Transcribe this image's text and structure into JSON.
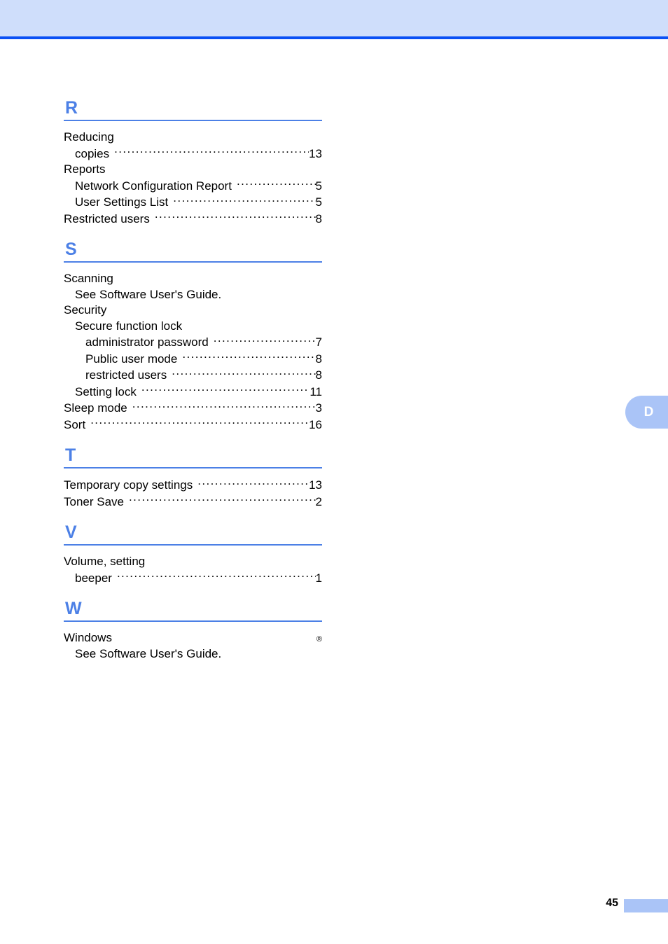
{
  "document": {
    "page_number": "45",
    "chapter_tab_letter": "D"
  },
  "colors": {
    "header_band": "#cfdefb",
    "header_rule": "#0a50f5",
    "section_letter": "#4c80e6",
    "section_rule": "#4c80e6",
    "tab_background": "#aac4f7",
    "tab_letter": "#ffffff",
    "footer_block": "#aac4f7",
    "text": "#000000"
  },
  "index": {
    "sections": [
      {
        "letter": "R",
        "entries": [
          {
            "level": 0,
            "label": "Reducing",
            "page": "",
            "leader": false
          },
          {
            "level": 1,
            "label": "copies",
            "page": "13",
            "leader": true
          },
          {
            "level": 0,
            "label": "Reports",
            "page": "",
            "leader": false
          },
          {
            "level": 1,
            "label": "Network Configuration Report",
            "page": "5",
            "leader": true
          },
          {
            "level": 1,
            "label": "User Settings List",
            "page": "5",
            "leader": true
          },
          {
            "level": 0,
            "label": "Restricted users",
            "page": "8",
            "leader": true
          }
        ]
      },
      {
        "letter": "S",
        "entries": [
          {
            "level": 0,
            "label": "Scanning",
            "page": "",
            "leader": false
          },
          {
            "level": 1,
            "label": "See Software User's Guide.",
            "page": "",
            "leader": false
          },
          {
            "level": 0,
            "label": "Security",
            "page": "",
            "leader": false
          },
          {
            "level": 1,
            "label": "Secure function lock",
            "page": "",
            "leader": false
          },
          {
            "level": 2,
            "label": "administrator password",
            "page": "7",
            "leader": true
          },
          {
            "level": 2,
            "label": "Public user mode",
            "page": "8",
            "leader": true
          },
          {
            "level": 2,
            "label": "restricted users",
            "page": "8",
            "leader": true
          },
          {
            "level": 1,
            "label": "Setting lock",
            "page": "11",
            "leader": true
          },
          {
            "level": 0,
            "label": "Sleep mode",
            "page": "3",
            "leader": true
          },
          {
            "level": 0,
            "label": "Sort",
            "page": "16",
            "leader": true
          }
        ]
      },
      {
        "letter": "T",
        "entries": [
          {
            "level": 0,
            "label": "Temporary copy settings",
            "page": "13",
            "leader": true
          },
          {
            "level": 0,
            "label": "Toner Save",
            "page": "2",
            "leader": true
          }
        ]
      },
      {
        "letter": "V",
        "entries": [
          {
            "level": 0,
            "label": "Volume, setting",
            "page": "",
            "leader": false
          },
          {
            "level": 1,
            "label": "beeper",
            "page": "1",
            "leader": true
          }
        ]
      },
      {
        "letter": "W",
        "entries": [
          {
            "level": 0,
            "label": "Windows",
            "superscript": "®",
            "page": "",
            "leader": false
          },
          {
            "level": 1,
            "label": "See Software User's Guide.",
            "page": "",
            "leader": false
          }
        ]
      }
    ]
  }
}
